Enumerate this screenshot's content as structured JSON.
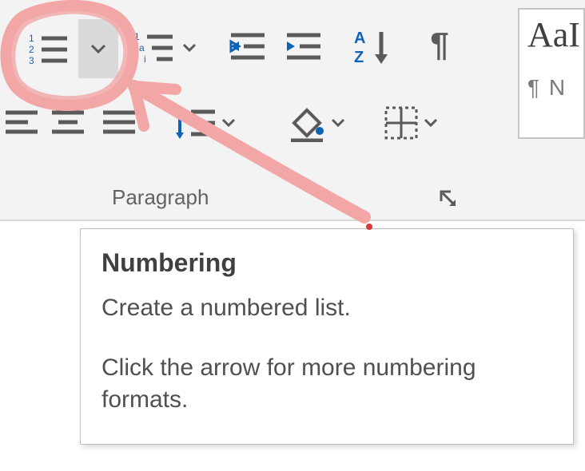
{
  "ribbon": {
    "group_label": "Paragraph",
    "numbering": {
      "icon": "numbering-icon",
      "dropdown_icon": "chevron-down-icon"
    },
    "multilevel": {
      "icon": "multilevel-list-icon",
      "dropdown_icon": "chevron-down-icon"
    },
    "decrease_indent": {
      "icon": "decrease-indent-icon"
    },
    "increase_indent": {
      "icon": "increase-indent-icon"
    },
    "sort": {
      "icon": "sort-az-icon"
    },
    "show_marks": {
      "icon": "pilcrow-icon"
    },
    "align_left": {
      "icon": "align-left-icon"
    },
    "align_center": {
      "icon": "align-center-icon"
    },
    "align_justify": {
      "icon": "align-justify-icon"
    },
    "line_spacing": {
      "icon": "line-spacing-icon",
      "dropdown_icon": "chevron-down-icon"
    },
    "shading": {
      "icon": "shading-bucket-icon",
      "dropdown_icon": "chevron-down-icon"
    },
    "borders": {
      "icon": "borders-icon",
      "dropdown_icon": "chevron-down-icon"
    },
    "dialog_launcher": {
      "icon": "dialog-launcher-icon"
    }
  },
  "style_preview": {
    "sample_text": "AaI",
    "secondary": "¶ N"
  },
  "tooltip": {
    "title": "Numbering",
    "line1": "Create a numbered list.",
    "line2": "Click the arrow for more numbering formats."
  }
}
